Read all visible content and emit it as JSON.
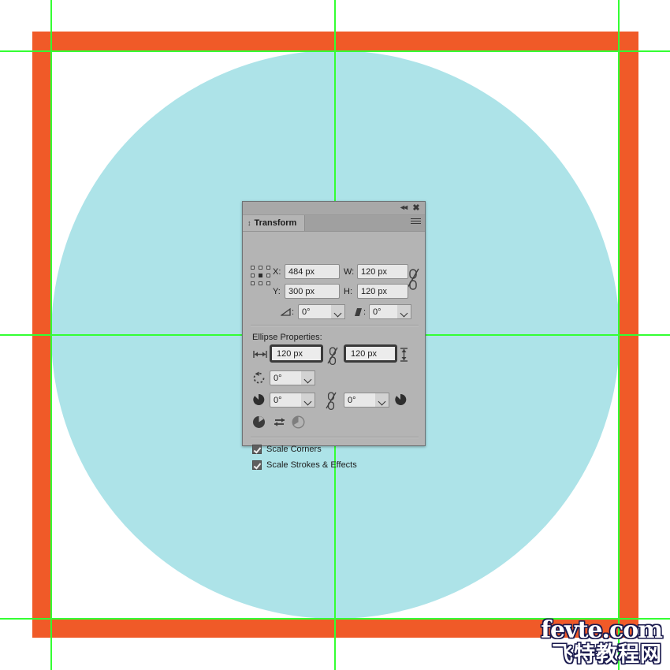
{
  "app": {
    "document_background": "#ffffff",
    "shape_fill": "#ade3e8",
    "frame_fill": "#f05a28",
    "guide_color": "#33ff33"
  },
  "artwork": {
    "orange_frame_name": "orange-square-frame",
    "circle_name": "teal-ellipse",
    "guides": [
      {
        "orientation": "vertical",
        "position": 65
      },
      {
        "orientation": "vertical",
        "position": 425
      },
      {
        "orientation": "vertical",
        "position": 785
      },
      {
        "orientation": "horizontal",
        "position": 65
      },
      {
        "orientation": "horizontal",
        "position": 425
      },
      {
        "orientation": "horizontal",
        "position": 785
      }
    ]
  },
  "panel": {
    "title": "Transform",
    "collapse_icon": "double-chevron-left-icon",
    "close_icon": "close-icon",
    "menu_icon": "panel-menu-icon",
    "reference_point": "center",
    "fields": {
      "x_label": "X:",
      "x_value": "484 px",
      "y_label": "Y:",
      "y_value": "300 px",
      "w_label": "W:",
      "w_value": "120 px",
      "h_label": "H:",
      "h_value": "120 px",
      "constrain_wh_icon": "broken-link-icon",
      "rotate_label_icon": "rotate-angle-icon",
      "rotate_value": "0°",
      "shear_label_icon": "shear-angle-icon",
      "shear_value": "0°"
    },
    "ellipse_section": {
      "title": "Ellipse Properties:",
      "width_icon": "horizontal-width-arrow-icon",
      "width_value": "120 px",
      "constrain_icon": "broken-link-icon",
      "height_value": "120 px",
      "height_icon": "vertical-height-arrow-icon",
      "pie_rotation_icon": "pie-rotation-icon",
      "pie_rotation_value": "0°",
      "pie_start_icon": "pie-start-angle-icon",
      "pie_start_value": "0°",
      "pie_link_icon": "broken-link-icon",
      "pie_end_value": "0°",
      "pie_end_icon": "pie-end-angle-icon",
      "invert_pie_icon": "pie-filled-icon",
      "swap_icon": "swap-arrows-icon",
      "pie_outline_icon": "pie-outline-icon"
    },
    "options": [
      {
        "label": "Scale Corners",
        "checked": true
      },
      {
        "label": "Scale Strokes & Effects",
        "checked": true
      }
    ]
  },
  "watermark": {
    "line1": "fevte.com",
    "line2": "飞特教程网"
  }
}
